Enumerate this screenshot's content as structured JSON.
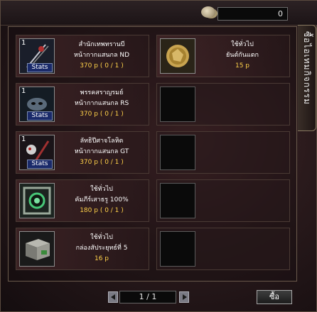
{
  "header": {
    "money_value": "0",
    "coin_icon": "coin-stack-icon"
  },
  "side_tab": {
    "label": "ซื้อไอเทมกิจกรรม"
  },
  "items": [
    {
      "qty": "1",
      "has_stats": true,
      "stats_label": "Stats",
      "title": "สำนักเทพทรานบี",
      "subtitle": "หน้ากากแสนกล ND",
      "price": "370 p  ( 0 / 1 )",
      "icon": "mask-nd-icon"
    },
    {
      "qty": "",
      "has_stats": false,
      "stats_label": "",
      "title": "ใช้ทั่วไป",
      "subtitle": "ยันต์กันแตก",
      "price": "15 p",
      "icon": "gold-talisman-icon"
    },
    {
      "qty": "1",
      "has_stats": true,
      "stats_label": "Stats",
      "title": "พรรคสราญรมย์",
      "subtitle": "หน้ากากแสนกล RS",
      "price": "370 p  ( 0 / 1 )",
      "icon": "mask-rs-icon"
    },
    {
      "qty": "1",
      "has_stats": true,
      "stats_label": "Stats",
      "title": "ลัทธิปีศาจโลหิต",
      "subtitle": "หน้ากากแสนกล GT",
      "price": "370 p  ( 0 / 1 )",
      "icon": "mask-gt-icon"
    },
    {
      "qty": "",
      "has_stats": false,
      "stats_label": "",
      "title": "ใช้ทั่วไป",
      "subtitle": "คัมภีร์เสาธรู 100%",
      "price": "180 p  ( 0 / 1 )",
      "icon": "green-scroll-icon"
    },
    {
      "qty": "",
      "has_stats": false,
      "stats_label": "",
      "title": "ใช้ทั่วไป",
      "subtitle": "กล่องสัประยุทธ์ที่ 5",
      "price": "16 p",
      "icon": "box-icon"
    }
  ],
  "footer": {
    "page_indicator": "1 / 1",
    "buy_label": "ซื้อ"
  }
}
